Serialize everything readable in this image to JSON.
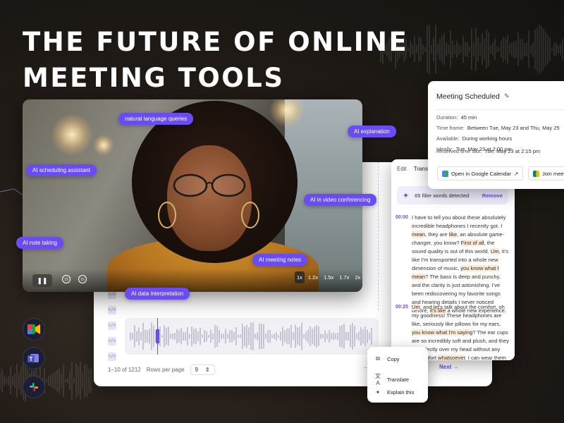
{
  "headline": {
    "line1": "THE FUTURE OF ONLINE",
    "line2": "MEETING TOOLS"
  },
  "video": {
    "controls": {
      "play_pause": "❚❚",
      "rewind": "15",
      "forward": "15"
    },
    "speeds": [
      "1x",
      "1.2x",
      "1.5x",
      "1.7x",
      "2x"
    ],
    "active_speed": "1x"
  },
  "tags": {
    "natural_language": "natural language queries",
    "ai_explanation": "AI explanation",
    "ai_scheduling": "AI scheduling assistant",
    "ai_video_conf": "AI in video conferencing",
    "ai_note_taking": "AI note taking",
    "ai_meeting_notes": "AI meeting notes",
    "ai_data": "AI data interpretation"
  },
  "transcript": {
    "tabs": [
      "Edit",
      "Transc"
    ],
    "filler": {
      "text": "65 filler words detected",
      "action": "Remove"
    },
    "blocks": [
      {
        "time": "00:00",
        "segments": [
          {
            "t": "I have to tell you about these absolutely incredible headphones I recently got. I ",
            "h": false
          },
          {
            "t": "mean",
            "h": true
          },
          {
            "t": ", they are ",
            "h": false
          },
          {
            "t": "like",
            "h": true
          },
          {
            "t": ", an absolute game-changer, you know? ",
            "h": false
          },
          {
            "t": "First of all",
            "h": true
          },
          {
            "t": ", the sound quality is out of this world. ",
            "h": false
          },
          {
            "t": "Um",
            "h": true
          },
          {
            "t": ", it's like I'm transported into a whole new dimension of music, ",
            "h": false
          },
          {
            "t": "you know what I mean",
            "h": true
          },
          {
            "t": "? The bass is deep and punchy, and the clarity is just astonishing. I've been rediscovering my favorite songs and hearing details I never noticed before, ",
            "h": false
          },
          {
            "t": "it's like",
            "h": true
          },
          {
            "t": " a whole new experience.",
            "h": false
          }
        ]
      },
      {
        "time": "00:25",
        "segments": [
          {
            "t": "Um",
            "h": true
          },
          {
            "t": ", and let's talk about the comfort, oh my goodness! These headphones are like, seriously like pillows for my ears, ",
            "h": false
          },
          {
            "t": "you know what I'm saying",
            "h": true
          },
          {
            "t": "? The ear cups are so incredibly soft and plush, and they fit perfectly over my head without any discomfort ",
            "h": false
          },
          {
            "t": "whatsoever",
            "h": true
          },
          {
            "t": ". I can wear them for hours on end, and I'm telling you, I",
            "h": false
          }
        ]
      }
    ]
  },
  "editor": {
    "range": "1–10 of 1212",
    "rows_label": "Rows per page",
    "rows_value": "9",
    "next": "Next →",
    "prev": "←"
  },
  "meeting": {
    "title": "Meeting Scheduled",
    "rows": [
      {
        "label": "Duration:",
        "value": "45 min"
      },
      {
        "label": "Time frame:",
        "value": "Between Tue, May 23 and Thu, May 25"
      },
      {
        "label": "Available:",
        "value": "During working hours"
      },
      {
        "label": "Ideally:",
        "value": "Tue, May 23 at 2:00 pm"
      },
      {
        "label": "Reserved time slot:",
        "value": "Tue, May 23 at 2:15 pm"
      }
    ],
    "btn_calendar": "Open in Google Calendar",
    "btn_join": "Join meet"
  },
  "context_menu": {
    "copy": "Copy",
    "translate": "Translate",
    "explain": "Explain this"
  },
  "apps": [
    "google-meet",
    "microsoft-teams",
    "slack"
  ],
  "colors": {
    "accent": "#6a4cf5",
    "highlight": "#fde9d6",
    "background": "#231d18"
  }
}
